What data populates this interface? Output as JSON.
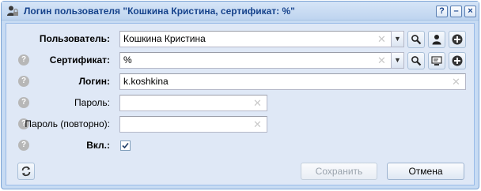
{
  "window": {
    "title": "Логин пользователя \"Кошкина Кристина, сертификат: %\"",
    "help_button": "?",
    "minimize_button": "–",
    "close_button": "×"
  },
  "form": {
    "user": {
      "label": "Пользователь:",
      "value": "Кошкина Кристина"
    },
    "certificate": {
      "label": "Сертификат:",
      "value": "%"
    },
    "login": {
      "label": "Логин:",
      "value": "k.koshkina"
    },
    "password": {
      "label": "Пароль:",
      "value": ""
    },
    "password_repeat": {
      "label": "Пароль (повторно):",
      "value": ""
    },
    "enabled": {
      "label": "Вкл.:",
      "checked": true
    }
  },
  "buttons": {
    "save": "Сохранить",
    "cancel": "Отмена"
  },
  "colors": {
    "title_text": "#15428b",
    "window_border": "#7ca3d4",
    "body_bg": "#dfe8f6"
  },
  "icons": [
    "user-lock-icon",
    "search-icon",
    "user-icon",
    "add-icon",
    "certificate-icon",
    "help-icon",
    "refresh-icon",
    "chevron-down-icon",
    "clear-icon",
    "checkmark-icon"
  ]
}
